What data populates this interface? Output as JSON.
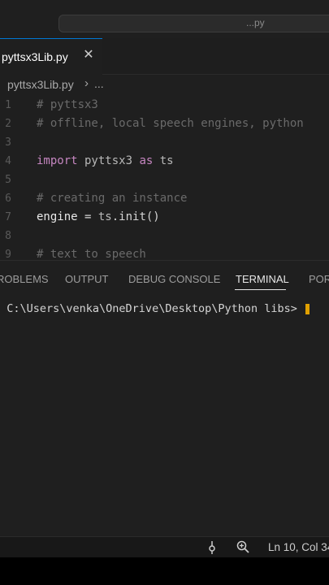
{
  "titlebar": {
    "search_text": "...py"
  },
  "tabs": {
    "active_label": "pyttsx3Lib.py",
    "close_glyph": "✕"
  },
  "breadcrumb": {
    "file": "pyttsx3Lib.py",
    "chevron": "›",
    "more": "..."
  },
  "editor": {
    "lines": [
      {
        "num": "1",
        "text": "# pyttsx3"
      },
      {
        "num": "2",
        "text": "# offline, local speech engines, python"
      },
      {
        "num": "3",
        "text": ""
      },
      {
        "num": "4",
        "tokens": [
          "import",
          " pyttsx3",
          " as",
          " ts"
        ]
      },
      {
        "num": "5",
        "text": ""
      },
      {
        "num": "6",
        "text": "# creating an instance"
      },
      {
        "num": "7",
        "tokens": [
          "engine",
          " = ",
          "ts",
          ".init()"
        ]
      },
      {
        "num": "8",
        "text": ""
      },
      {
        "num": "9",
        "text": "# text to speech"
      }
    ]
  },
  "panel": {
    "tabs": [
      "ROBLEMS",
      "OUTPUT",
      "DEBUG CONSOLE",
      "TERMINAL",
      "POR"
    ],
    "active_tab": "TERMINAL",
    "terminal_line": "S C:\\Users\\venka\\OneDrive\\Desktop\\Python libs> "
  },
  "statusbar": {
    "sync_icon": "sync-icon",
    "zoom_icon": "zoom-icon",
    "position": "Ln 10, Col 34"
  },
  "colors": {
    "editor_bg": "#1f1f1f",
    "keyword": "#c586c0",
    "comment": "#6a6a6a",
    "accent": "#0078d4",
    "cursor": "#e0a000"
  }
}
